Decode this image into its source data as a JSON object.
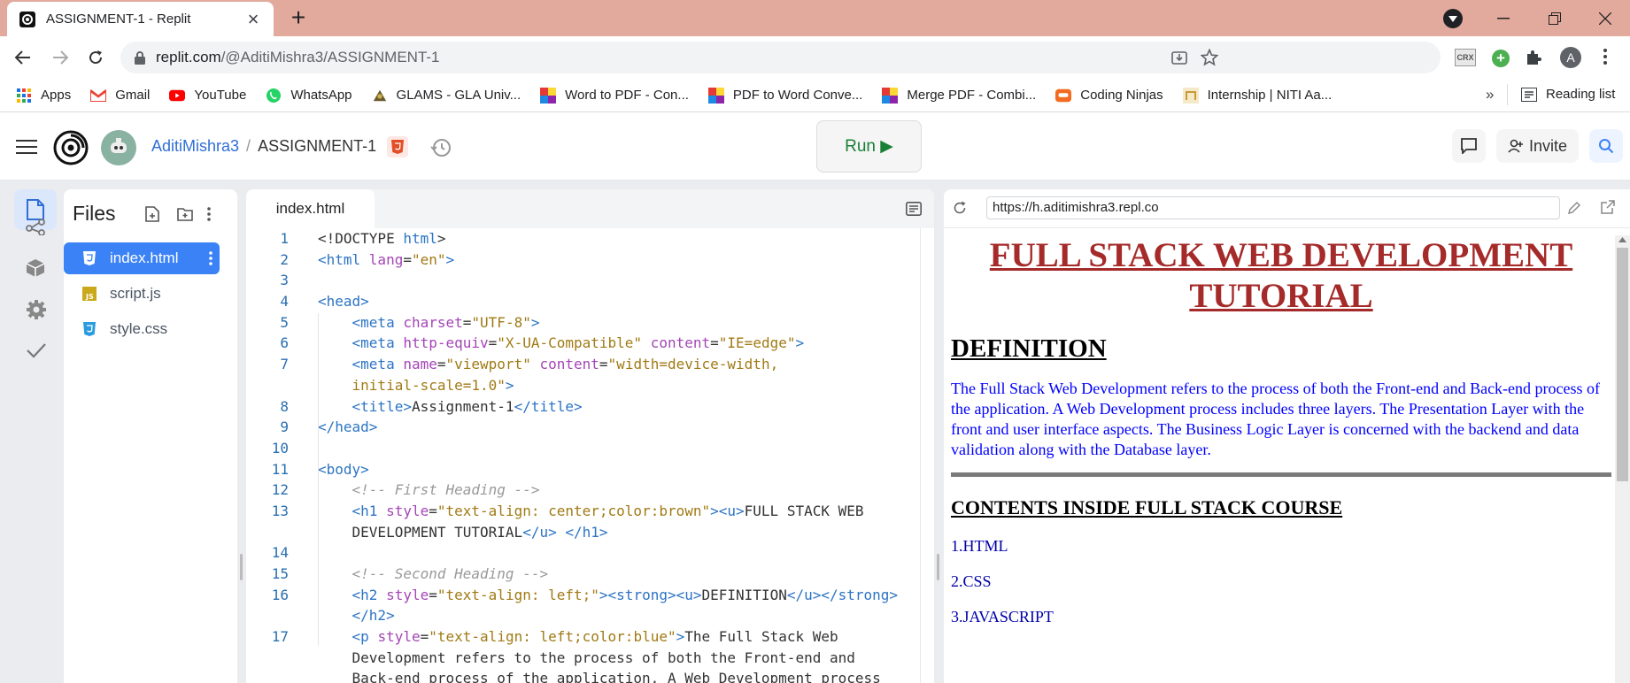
{
  "browser": {
    "tab_title": "ASSIGNMENT-1 - Replit",
    "url_host": "replit.com",
    "url_path": "/@AditiMishra3/ASSIGNMENT-1",
    "profile_initial": "A",
    "crx_label": "CRX",
    "bookmarks": [
      {
        "label": "Apps",
        "icon": "apps-grid-icon"
      },
      {
        "label": "Gmail",
        "icon": "gmail-icon"
      },
      {
        "label": "YouTube",
        "icon": "youtube-icon"
      },
      {
        "label": "WhatsApp",
        "icon": "whatsapp-icon"
      },
      {
        "label": "GLAMS - GLA Univ...",
        "icon": "glams-icon"
      },
      {
        "label": "Word to PDF - Con...",
        "icon": "ilovepdf-icon"
      },
      {
        "label": "PDF to Word Conve...",
        "icon": "ilovepdf-icon"
      },
      {
        "label": "Merge PDF - Combi...",
        "icon": "ilovepdf-icon"
      },
      {
        "label": "Coding Ninjas",
        "icon": "coding-ninjas-icon"
      },
      {
        "label": "Internship | NITI Aa...",
        "icon": "niti-icon"
      }
    ],
    "bookmarks_overflow": "»",
    "reading_list": "Reading list"
  },
  "replit": {
    "username": "AditiMishra3",
    "separator": "/",
    "repl_name": "ASSIGNMENT-1",
    "run_label": "Run ▶",
    "invite_label": "Invite",
    "files_title": "Files",
    "files": [
      {
        "name": "index.html",
        "type": "html",
        "selected": true
      },
      {
        "name": "script.js",
        "type": "js",
        "selected": false
      },
      {
        "name": "style.css",
        "type": "css",
        "selected": false
      }
    ],
    "editor_tab": "index.html",
    "preview_url": "https://h.aditimishra3.repl.co"
  },
  "code_lines": [
    {
      "n": "1",
      "html": "<span class='k'>&lt;!DOCTYPE </span><span class='t'>html</span><span class='k'>&gt;</span>"
    },
    {
      "n": "2",
      "html": "<span class='t'>&lt;html </span><span class='a'>lang</span><span class='k'>=</span><span class='s'>\"en\"</span><span class='t'>&gt;</span>"
    },
    {
      "n": "3",
      "html": ""
    },
    {
      "n": "4",
      "html": "<span class='t'>&lt;head&gt;</span>"
    },
    {
      "n": "5",
      "html": "    <span class='t'>&lt;meta </span><span class='a'>charset</span><span class='k'>=</span><span class='s'>\"UTF-8\"</span><span class='t'>&gt;</span>"
    },
    {
      "n": "6",
      "html": "    <span class='t'>&lt;meta </span><span class='a'>http-equiv</span><span class='k'>=</span><span class='s'>\"X-UA-Compatible\"</span> <span class='a'>content</span><span class='k'>=</span><span class='s'>\"IE=edge\"</span><span class='t'>&gt;</span>"
    },
    {
      "n": "7",
      "html": "    <span class='t'>&lt;meta </span><span class='a'>name</span><span class='k'>=</span><span class='s'>\"viewport\"</span> <span class='a'>content</span><span class='k'>=</span><span class='s'>\"width=device-width,</span>"
    },
    {
      "n": "",
      "html": "    <span class='s'>initial-scale=1.0\"</span><span class='t'>&gt;</span>"
    },
    {
      "n": "8",
      "html": "    <span class='t'>&lt;title&gt;</span><span class='k'>Assignment-1</span><span class='t'>&lt;/title&gt;</span>"
    },
    {
      "n": "9",
      "html": "<span class='t'>&lt;/head&gt;</span>"
    },
    {
      "n": "10",
      "html": ""
    },
    {
      "n": "11",
      "html": "<span class='t'>&lt;body&gt;</span>"
    },
    {
      "n": "12",
      "html": "    <span class='c'>&lt;!-- First Heading --&gt;</span>"
    },
    {
      "n": "13",
      "html": "    <span class='t'>&lt;h1 </span><span class='a'>style</span><span class='k'>=</span><span class='s'>\"text-align: center;color:brown\"</span><span class='t'>&gt;&lt;u&gt;</span><span class='k'>FULL STACK WEB</span>"
    },
    {
      "n": "",
      "html": "    <span class='k'>DEVELOPMENT TUTORIAL</span><span class='t'>&lt;/u&gt;</span> <span class='t'>&lt;/h1&gt;</span>"
    },
    {
      "n": "14",
      "html": ""
    },
    {
      "n": "15",
      "html": "    <span class='c'>&lt;!-- Second Heading --&gt;</span>"
    },
    {
      "n": "16",
      "html": "    <span class='t'>&lt;h2 </span><span class='a'>style</span><span class='k'>=</span><span class='s'>\"text-align: left;\"</span><span class='t'>&gt;&lt;strong&gt;&lt;u&gt;</span><span class='k'>DEFINITION</span><span class='t'>&lt;/u&gt;&lt;/strong&gt;</span>"
    },
    {
      "n": "",
      "html": "    <span class='t'>&lt;/h2&gt;</span>"
    },
    {
      "n": "17",
      "html": "    <span class='t'>&lt;p </span><span class='a'>style</span><span class='k'>=</span><span class='s'>\"text-align: left;color:blue\"</span><span class='t'>&gt;</span><span class='k'>The Full Stack Web</span>"
    },
    {
      "n": "",
      "html": "    <span class='k'>Development refers to the process of both the Front-end and</span>"
    },
    {
      "n": "",
      "html": "    <span class='k'>Back-end process of the application. A Web Development process</span>"
    }
  ],
  "preview_page": {
    "h1": "FULL STACK WEB DEVELOPMENT TUTORIAL",
    "h2": "DEFINITION",
    "paragraph": "The Full Stack Web Development refers to the process of both the Front-end and Back-end process of the application. A Web Development process includes three layers. The Presentation Layer with the front and user interface aspects. The Business Logic Layer is concerned with the backend and data validation along with the Database layer.",
    "h3": "CONTENTS INSIDE FULL STACK COURSE",
    "list": [
      "1.HTML",
      "2.CSS",
      "3.JAVASCRIPT"
    ]
  },
  "colors": {
    "tabstrip": "#e2a99d",
    "accent_blue": "#3b82f6",
    "run_green": "#1a7f37",
    "heading_brown": "#a52a2a"
  }
}
